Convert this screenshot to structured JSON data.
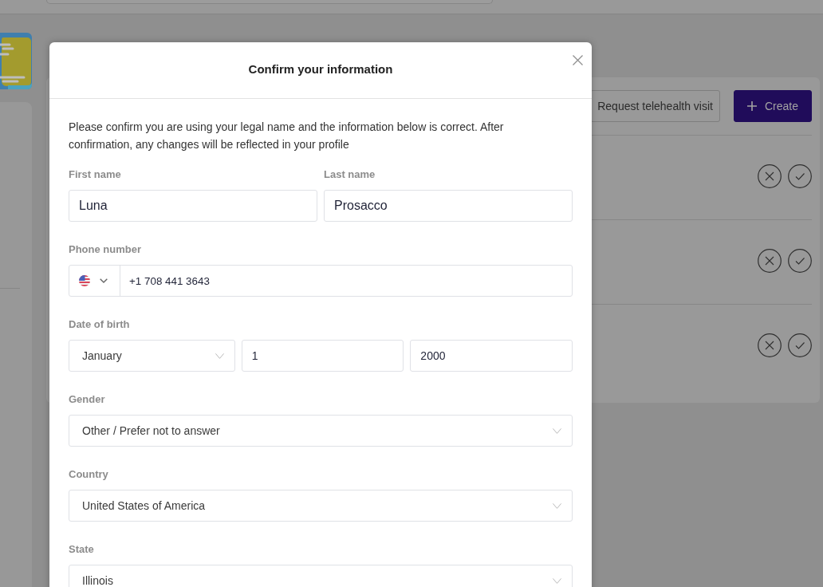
{
  "toolbar": {
    "buttons": [
      {
        "label": "Request telehealth visit",
        "kind": "outline"
      },
      {
        "label": "Create",
        "kind": "primary"
      }
    ]
  },
  "list": {
    "rows": [
      {
        "actions": [
          {
            "kind": "decline"
          },
          {
            "kind": "accept"
          }
        ]
      },
      {
        "actions": [
          {
            "kind": "decline"
          },
          {
            "kind": "accept"
          }
        ]
      },
      {
        "actions": [
          {
            "kind": "decline"
          },
          {
            "kind": "accept"
          }
        ]
      }
    ]
  },
  "dialog": {
    "title": "Confirm your information",
    "intro": "Please confirm you are using your legal name and the information below is correct. After confirmation, any changes will be reflected in your profile",
    "rows": [
      {
        "fields": [
          {
            "label": "First name",
            "kind": "text",
            "value": "Luna"
          },
          {
            "label": "Last name",
            "kind": "text",
            "value": "Prosacco"
          }
        ]
      },
      {
        "fields": [
          {
            "label": "Phone number",
            "kind": "phone",
            "value": "+1 708 441 3643"
          }
        ]
      },
      {
        "fields": [
          {
            "label": "Date of birth",
            "kind": "date",
            "parts": [
              {
                "kind": "select",
                "value": "January"
              },
              {
                "kind": "text",
                "value": "1"
              },
              {
                "kind": "text",
                "value": "2000"
              }
            ]
          }
        ]
      },
      {
        "fields": [
          {
            "label": "Gender",
            "kind": "select",
            "value": "Other / Prefer not to answer"
          }
        ]
      },
      {
        "fields": [
          {
            "label": "Country",
            "kind": "select",
            "value": "United States of America"
          }
        ]
      },
      {
        "fields": [
          {
            "label": "State",
            "kind": "select",
            "value": "Illinois"
          }
        ]
      }
    ]
  }
}
